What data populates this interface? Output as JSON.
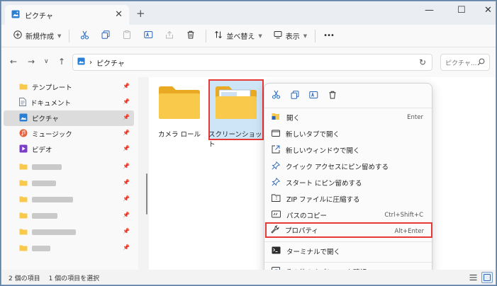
{
  "window": {
    "tab_title": "ピクチャ",
    "tab_close": "✕",
    "new_tab": "+",
    "minimize": "—",
    "maximize": "☐",
    "close": "✕"
  },
  "toolbar": {
    "new_label": "新規作成",
    "sort_label": "並べ替え",
    "view_label": "表示",
    "more": "•••"
  },
  "address": {
    "path": "ピクチャ",
    "separator": "›",
    "search_placeholder": "ピクチャ..."
  },
  "sidebar": {
    "items": [
      {
        "label": "テンプレート",
        "icon": "folder-icon"
      },
      {
        "label": "ドキュメント",
        "icon": "document-icon"
      },
      {
        "label": "ピクチャ",
        "icon": "pictures-icon",
        "selected": true
      },
      {
        "label": "ミュージック",
        "icon": "music-icon"
      },
      {
        "label": "ビデオ",
        "icon": "video-icon"
      }
    ]
  },
  "content": {
    "folders": [
      {
        "label": "カメラ ロール"
      },
      {
        "label": "スクリーンショット"
      }
    ]
  },
  "context_menu": {
    "items": [
      {
        "label": "開く",
        "shortcut": "Enter"
      },
      {
        "label": "新しいタブで開く",
        "shortcut": ""
      },
      {
        "label": "新しいウィンドウで開く",
        "shortcut": ""
      },
      {
        "label": "クイック アクセスにピン留めする",
        "shortcut": ""
      },
      {
        "label": "スタート にピン留めする",
        "shortcut": ""
      },
      {
        "label": "ZIP ファイルに圧縮する",
        "shortcut": ""
      },
      {
        "label": "パスのコピー",
        "shortcut": "Ctrl+Shift+C"
      },
      {
        "label": "プロパティ",
        "shortcut": "Alt+Enter"
      },
      {
        "label": "ターミナルで開く",
        "shortcut": ""
      },
      {
        "label": "その他のオプションを確認",
        "shortcut": ""
      }
    ]
  },
  "status": {
    "item_count": "2 個の項目",
    "selected_count": "1 個の項目を選択"
  },
  "colors": {
    "accent": "#0067c0",
    "highlight_border": "#e53935",
    "folder_yellow": "#f8c94a"
  }
}
